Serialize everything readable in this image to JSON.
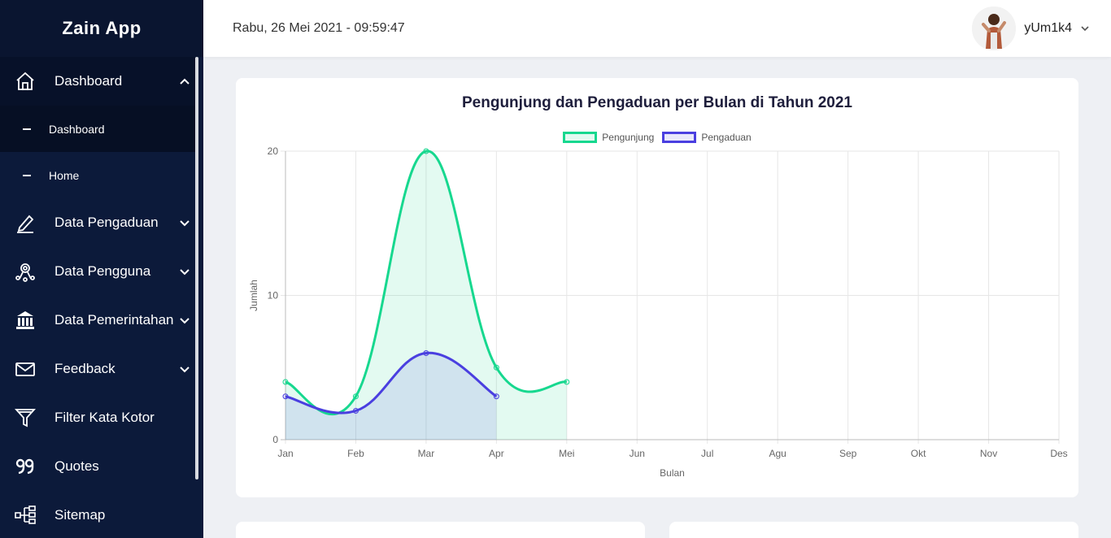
{
  "app": {
    "title": "Zain App"
  },
  "topbar": {
    "datetime": "Rabu, 26 Mei 2021 - 09:59:47",
    "username": "yUm1k4"
  },
  "sidebar": {
    "dashboard": {
      "label": "Dashboard",
      "sub": [
        "Dashboard",
        "Home"
      ]
    },
    "items": [
      {
        "label": "Data Pengaduan",
        "icon": "pencil-icon",
        "has_chevron": true
      },
      {
        "label": "Data Pengguna",
        "icon": "users-network-icon",
        "has_chevron": true
      },
      {
        "label": "Data Pemerintahan",
        "icon": "bank-icon",
        "has_chevron": true
      },
      {
        "label": "Feedback",
        "icon": "envelope-icon",
        "has_chevron": true
      },
      {
        "label": "Filter Kata Kotor",
        "icon": "funnel-icon",
        "has_chevron": false
      },
      {
        "label": "Quotes",
        "icon": "quote-icon",
        "has_chevron": false
      },
      {
        "label": "Sitemap",
        "icon": "sitemap-icon",
        "has_chevron": false
      }
    ]
  },
  "colors": {
    "sidebar": "#0c1a3a",
    "pengunjung": "#17d88f",
    "pengaduan": "#4a3fe0"
  },
  "chart_data": {
    "type": "line",
    "title": "Pengunjung dan Pengaduan per Bulan di Tahun 2021",
    "xlabel": "Bulan",
    "ylabel": "Jumlah",
    "categories": [
      "Jan",
      "Feb",
      "Mar",
      "Apr",
      "Mei",
      "Jun",
      "Jul",
      "Agu",
      "Sep",
      "Okt",
      "Nov",
      "Des"
    ],
    "ylim": [
      0,
      20
    ],
    "yticks": [
      0,
      10,
      20
    ],
    "grid": true,
    "legend": "top-center",
    "series": [
      {
        "name": "Pengunjung",
        "values": [
          4,
          3,
          20,
          5,
          4
        ],
        "color": "#17d88f",
        "fill": "rgba(23,216,143,0.12)"
      },
      {
        "name": "Pengaduan",
        "values": [
          3,
          2,
          6,
          3
        ],
        "color": "#4a3fe0",
        "fill": "rgba(74,63,224,0.12)"
      }
    ]
  }
}
